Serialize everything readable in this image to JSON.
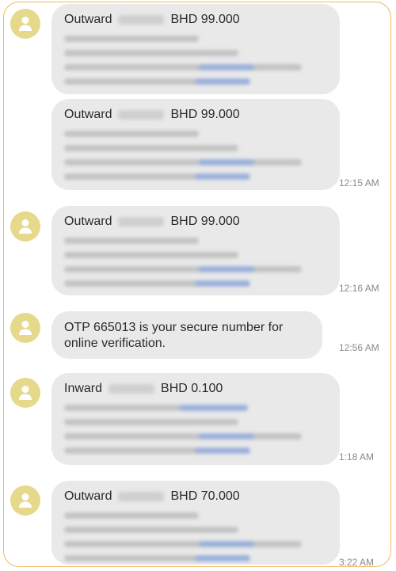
{
  "messages": [
    {
      "type": "Outward",
      "amount": "BHD 99.000",
      "time": ""
    },
    {
      "type": "Outward",
      "amount": "BHD 99.000",
      "time": "12:15 AM"
    },
    {
      "type": "Outward",
      "amount": "BHD 99.000",
      "time": "12:16 AM"
    },
    {
      "otp": "OTP 665013 is your secure number for online verification.",
      "time": "12:56 AM"
    },
    {
      "type": "Inward",
      "amount": "BHD 0.100",
      "time": "1:18 AM"
    },
    {
      "type": "Outward",
      "amount": "BHD 70.000",
      "time": "3:22 AM"
    }
  ],
  "colors": {
    "frame_border": "#f0b865",
    "bubble": "#e9e9ea",
    "avatar": "#e6d98b",
    "avatar_icon": "#ffffff"
  },
  "icons": {
    "avatar": "person-icon"
  }
}
